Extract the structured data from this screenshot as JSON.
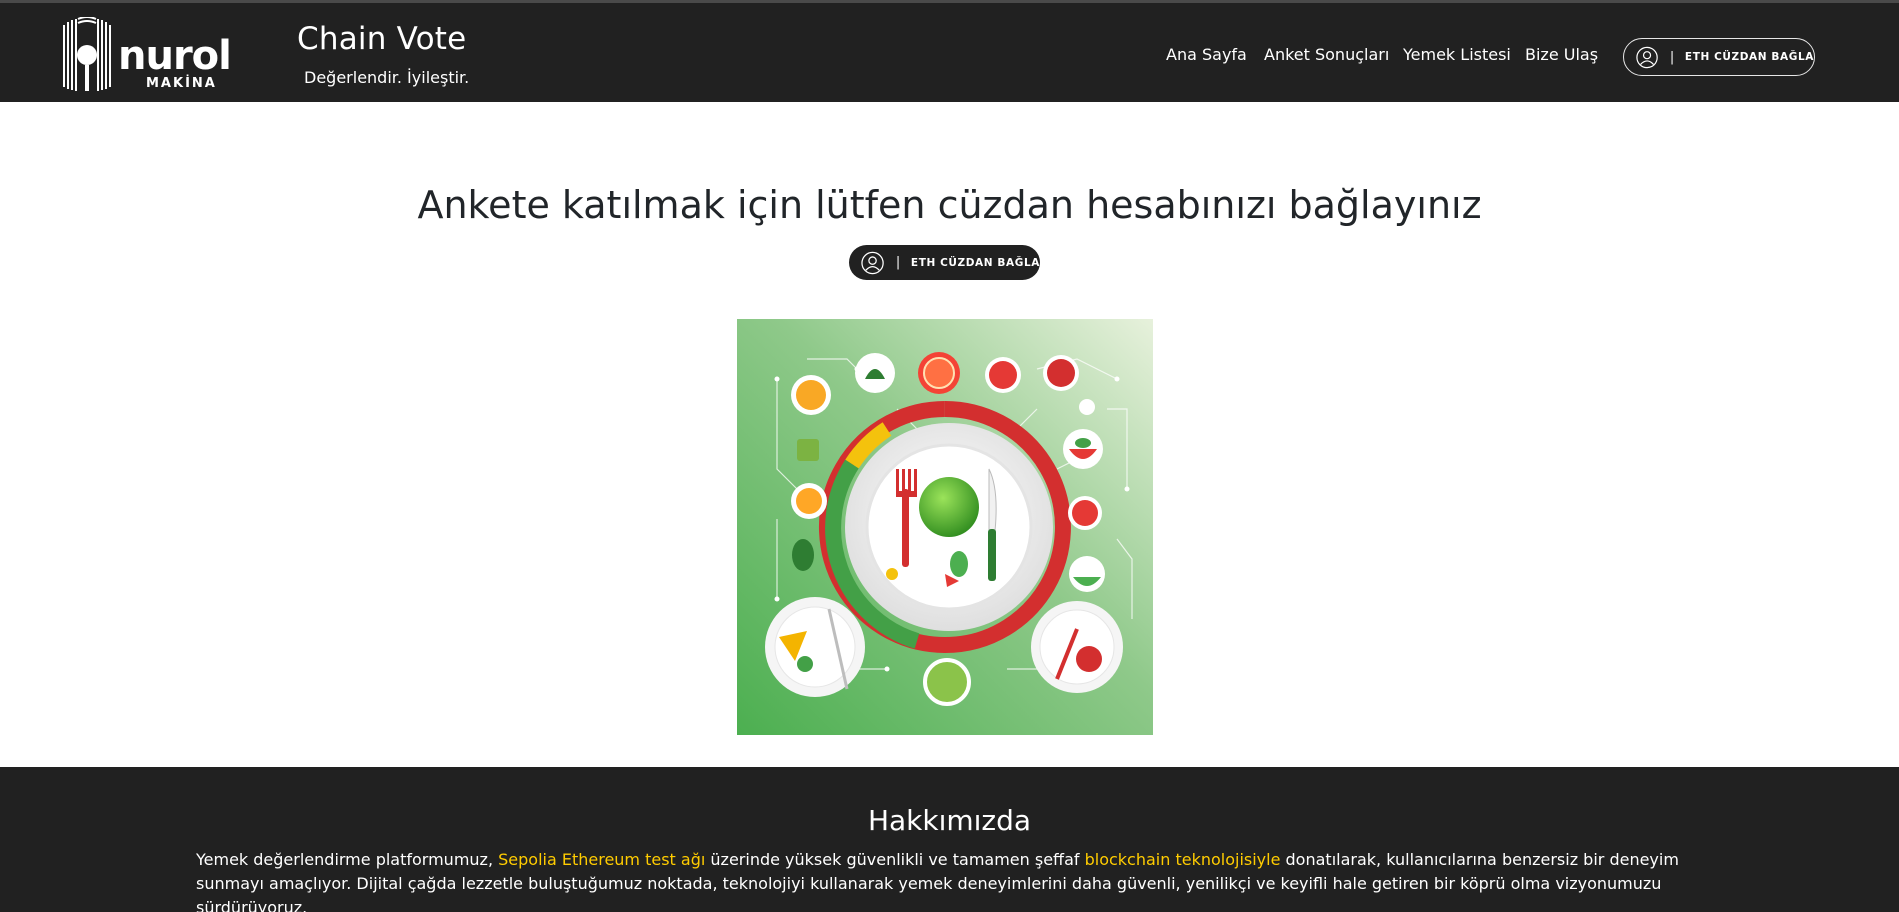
{
  "header": {
    "logo_text": "nurol",
    "logo_subtext": "MAKİNA",
    "title": "Chain Vote",
    "tagline": "Değerlendir. İyileştir.",
    "nav": [
      "Ana Sayfa",
      "Anket Sonuçları",
      "Yemek Listesi",
      "Bize Ulaş"
    ],
    "wallet_button": {
      "separator": "|",
      "label": "ETH CÜZDAN BAĞLA",
      "icon": "user-circle-icon"
    }
  },
  "main": {
    "heading": "Ankete katılmak için lütfen cüzdan hesabınızı bağlayınız",
    "wallet_button": {
      "separator": "|",
      "label": "ETH CÜZDAN BAĞLA",
      "icon": "user-circle-icon"
    }
  },
  "about": {
    "title": "Hakkımızda",
    "text_1": "Yemek değerlendirme platformumuz, ",
    "highlight_1": "Sepolia Ethereum test ağı",
    "text_2": " üzerinde yüksek güvenlikli ve tamamen şeffaf ",
    "highlight_2": "blockchain teknolojisiyle",
    "text_3": " donatılarak, kullanıcılarına benzersiz bir deneyim sunmayı amaçlıyor. Dijital çağda lezzetle buluştuğumuz noktada, teknolojiyi kullanarak yemek deneyimlerini daha güvenli, yenilikçi ve keyifli hale getiren bir köprü olma vizyonumuzu sürdürüyoruz."
  },
  "colors": {
    "header_bg": "#212121",
    "footer_bg": "#212121",
    "highlight": "#ffcc00",
    "text_dark": "#212529"
  }
}
